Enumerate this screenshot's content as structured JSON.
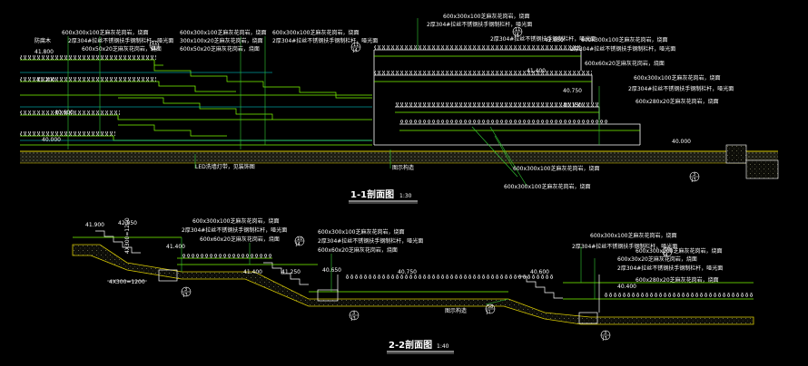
{
  "colors": {
    "background": "#000000",
    "line_green": "#7CFC00",
    "line_yellow": "#d6c800",
    "line_cyan": "#00e5e5",
    "leader_green": "#33cc33",
    "text_white": "#ffffff",
    "hatch_gray": "#8c8c8c"
  },
  "section_1": {
    "title": "1-1剖面图",
    "scale": "1:30",
    "elevations": [
      "41.800",
      "41.200",
      "40.600",
      "40.000",
      "42.050",
      "41.400",
      "40.750",
      "40.150",
      "40.000"
    ],
    "notes": [
      "600x300x100芝麻灰花岗岩，烧面",
      "2厚304#拉丝不锈钢扶手钢制栏杆，哑光面",
      "600x50x20芝麻灰花岗岩，烧面",
      "600x300x100芝麻灰花岗岩，烧面",
      "2厚304#拉丝不锈钢扶手钢制栏杆，哑光面",
      "300x100x20芝麻灰花岗岩，烧面",
      "600x50x20芝麻灰花岗岩，烧面",
      "600x300x100芝麻灰花岗岩，烧面",
      "2厚304#拉丝不锈钢扶手钢制栏杆，哑光面",
      "600x300x100芝麻灰花岗岩，烧面",
      "2厚304#拉丝不锈钢扶手钢制栏杆，哑光面",
      "600x60x20芝麻灰花岗岩，烧面",
      "600x300x100芝麻灰花岗岩，烧面",
      "2厚304#拉丝不锈钢扶手钢制栏杆，哑光面",
      "600x300x100芝麻灰花岗岩，烧面",
      "600x280x20芝麻灰花岗岩，烧面",
      "2厚304#拉丝不锈钢扶手钢制栏杆，哑光面",
      "600x300x100芝麻灰花岗岩，烧面",
      "LED洗墙灯带，见装饰图",
      "图示构造",
      "防腐木",
      "600x300x100芝麻灰花岗岩，烧面"
    ],
    "tags": [
      {
        "top": "11",
        "bottom": "J4"
      },
      {
        "top": "11",
        "bottom": "J4"
      },
      {
        "top": "11",
        "bottom": "J4"
      },
      {
        "top": "3",
        "bottom": "J3"
      }
    ]
  },
  "section_2": {
    "title": "2-2剖面图",
    "scale": "1:40",
    "dimension": "4X300=1200",
    "dimension_2": "4X300=1200",
    "elevations": [
      "41.900",
      "42.050",
      "41.400",
      "41.400",
      "41.250",
      "40.650",
      "40.750",
      "40.600",
      "40.400"
    ],
    "notes": [
      "600x300x100芝麻灰花岗岩，烧面",
      "2厚304#拉丝不锈钢扶手钢制栏杆，哑光面",
      "600x60x20芝麻灰花岗岩，烧面",
      "600x300x100芝麻灰花岗岩，烧面",
      "2厚304#拉丝不锈钢扶手钢制栏杆，哑光面",
      "600x60x20芝麻灰花岗岩，烧面",
      "600x300x100芝麻灰花岗岩，烧面",
      "2厚304#拉丝不锈钢扶手钢制栏杆，哑光面",
      "600x30x20芝麻灰花岗岩，烧面",
      "600x300x100芝麻灰花岗岩，烧面",
      "600x280x20芝麻灰花岗岩，烧面",
      "2厚304#拉丝不锈钢扶手钢制栏杆，哑光面",
      "图示构造"
    ],
    "tags": [
      {
        "top": "3",
        "bottom": "J3"
      },
      {
        "top": "10",
        "bottom": "J4"
      },
      {
        "top": "3",
        "bottom": "J3"
      },
      {
        "top": "10",
        "bottom": "J4"
      },
      {
        "top": "58",
        "bottom": "J1"
      },
      {
        "top": "3",
        "bottom": "J3"
      }
    ]
  }
}
